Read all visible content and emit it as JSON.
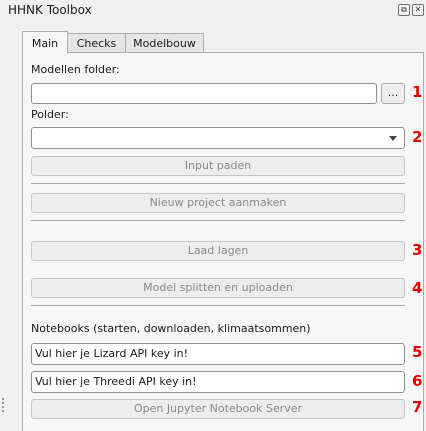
{
  "window": {
    "title": "HHNK Toolbox"
  },
  "tabs": [
    {
      "label": "Main",
      "active": true
    },
    {
      "label": "Checks",
      "active": false
    },
    {
      "label": "Modelbouw",
      "active": false
    }
  ],
  "main": {
    "modellen_folder_label": "Modellen folder:",
    "modellen_folder_value": "",
    "browse_label": "...",
    "polder_label": "Polder:",
    "polder_value": "",
    "input_paden_label": "Input paden",
    "nieuw_project_label": "Nieuw project aanmaken",
    "laad_lagen_label": "Laad lagen",
    "model_splitten_label": "Model splitten en uploaden",
    "notebooks_label": "Notebooks (starten, downloaden, klimaatsommen)",
    "lizard_key_value": "Vul hier je Lizard API key in!",
    "threedi_key_value": "Vul hier je Threedi API key in!",
    "jupyter_label": "Open Jupyter Notebook Server"
  },
  "markers": [
    "1",
    "2",
    "3",
    "4",
    "5",
    "6",
    "7"
  ],
  "colors": {
    "marker": "#e50000",
    "background": "#f0f0f0"
  },
  "icons": {
    "float": "restore-icon",
    "close": "close-icon",
    "dropdown": "chevron-down-icon"
  }
}
